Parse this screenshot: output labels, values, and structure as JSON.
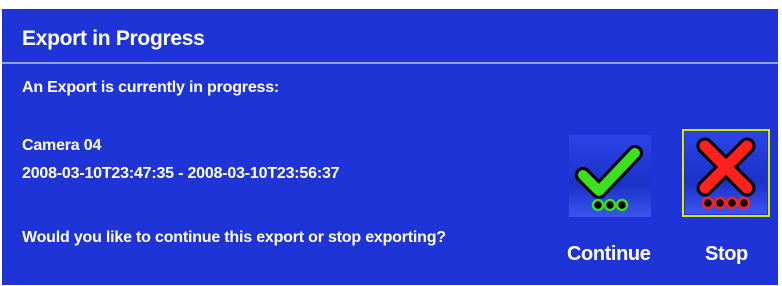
{
  "dialog": {
    "title": "Export in Progress",
    "intro": "An Export is currently in progress:",
    "camera": "Camera 04",
    "time_range": "2008-03-10T23:47:35 - 2008-03-10T23:56:37",
    "question": "Would you like to continue this export or stop exporting?"
  },
  "actions": {
    "continue_label": "Continue",
    "continue_icon": "green-check-icon",
    "stop_label": "Stop",
    "stop_icon": "red-x-icon"
  },
  "colors": {
    "background": "#1f34d6",
    "text": "#ffffff",
    "check": "#3be020",
    "cross": "#ff2020",
    "focus": "#d8e800"
  }
}
